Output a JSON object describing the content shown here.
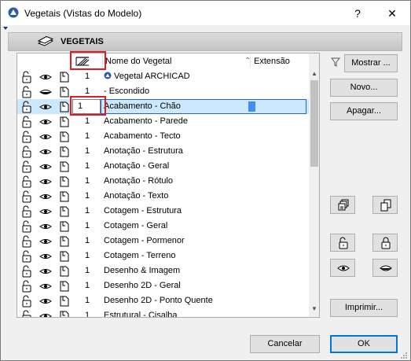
{
  "window": {
    "title": "Vegetais (Vistas do Modelo)",
    "help_glyph": "?",
    "close_glyph": "✕"
  },
  "band": {
    "label": "VEGETAIS"
  },
  "table": {
    "headers": {
      "name": "Nome do Vegetal",
      "extension": "Extensão"
    },
    "rows": [
      {
        "num": "1",
        "name": "Vegetal ARCHICAD",
        "archicad_icon": true
      },
      {
        "num": "1",
        "name": "- Escondido",
        "hidden": true
      },
      {
        "num": "1",
        "name": "Acabamento - Chão",
        "selected": true
      },
      {
        "num": "1",
        "name": "Acabamento - Parede"
      },
      {
        "num": "1",
        "name": "Acabamento - Tecto"
      },
      {
        "num": "1",
        "name": "Anotação - Estrutura"
      },
      {
        "num": "1",
        "name": "Anotação - Geral"
      },
      {
        "num": "1",
        "name": "Anotação - Rótulo"
      },
      {
        "num": "1",
        "name": "Anotação - Texto"
      },
      {
        "num": "1",
        "name": "Cotagem - Estrutura"
      },
      {
        "num": "1",
        "name": "Cotagem - Geral"
      },
      {
        "num": "1",
        "name": "Cotagem - Pormenor"
      },
      {
        "num": "1",
        "name": "Cotagem - Terreno"
      },
      {
        "num": "1",
        "name": "Desenho & Imagem"
      },
      {
        "num": "1",
        "name": "Desenho 2D - Geral"
      },
      {
        "num": "1",
        "name": "Desenho 2D - Ponto Quente"
      },
      {
        "num": "1",
        "name": "Estrutural - Cisalha"
      }
    ]
  },
  "buttons": {
    "show": "Mostrar ...",
    "new": "Novo...",
    "delete": "Apagar...",
    "print": "Imprimir...",
    "cancel": "Cancelar",
    "ok": "OK"
  },
  "colors": {
    "selection": "#cce8ff",
    "highlight": "#e01b24",
    "extension_swatch": "#3e8ef7",
    "primary_border": "#0078d7"
  }
}
